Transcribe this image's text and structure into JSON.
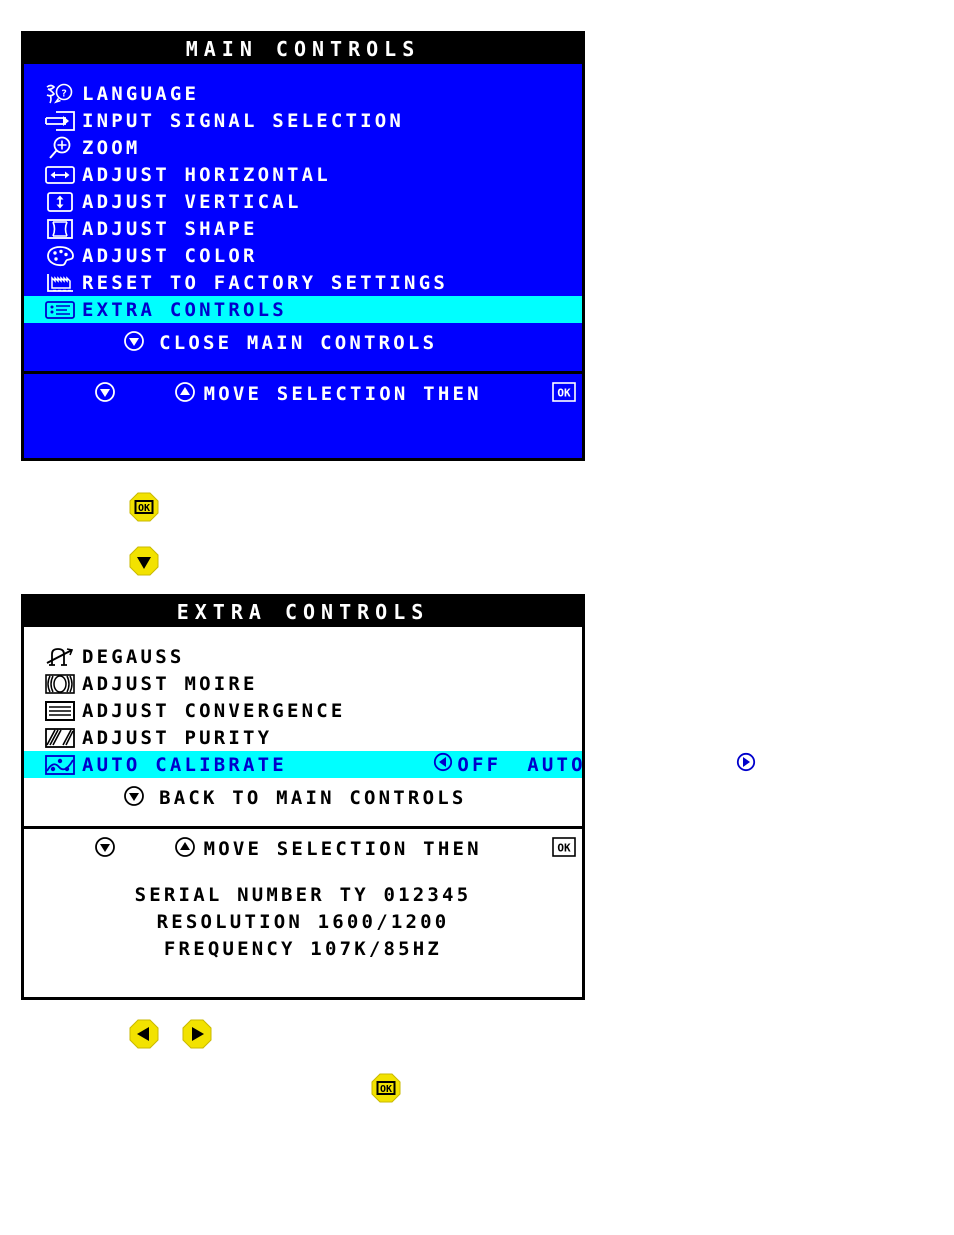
{
  "main_controls": {
    "title": "MAIN CONTROLS",
    "items": [
      {
        "icon": "language-icon",
        "label": "LANGUAGE",
        "selected": false
      },
      {
        "icon": "input-signal-icon",
        "label": "INPUT SIGNAL SELECTION",
        "selected": false
      },
      {
        "icon": "zoom-icon",
        "label": "ZOOM",
        "selected": false
      },
      {
        "icon": "adjust-horizontal-icon",
        "label": "ADJUST HORIZONTAL",
        "selected": false
      },
      {
        "icon": "adjust-vertical-icon",
        "label": "ADJUST VERTICAL",
        "selected": false
      },
      {
        "icon": "adjust-shape-icon",
        "label": "ADJUST SHAPE",
        "selected": false
      },
      {
        "icon": "adjust-color-icon",
        "label": "ADJUST COLOR",
        "selected": false
      },
      {
        "icon": "factory-reset-icon",
        "label": "RESET TO FACTORY SETTINGS",
        "selected": false
      },
      {
        "icon": "extra-controls-icon",
        "label": "EXTRA CONTROLS",
        "selected": true
      }
    ],
    "close_icon": "down-arrow-circle-icon",
    "close_label": "CLOSE MAIN CONTROLS",
    "hint_icon_down": "down-arrow-circle-icon",
    "hint_icon_up": "up-arrow-circle-icon",
    "hint_label": "MOVE SELECTION THEN",
    "hint_ok_icon": "ok-key-icon",
    "hint_ok_label": "OK"
  },
  "extra_controls": {
    "title": "EXTRA CONTROLS",
    "items": [
      {
        "icon": "degauss-icon",
        "label": "DEGAUSS",
        "selected": false
      },
      {
        "icon": "adjust-moire-icon",
        "label": "ADJUST MOIRE",
        "selected": false
      },
      {
        "icon": "adjust-convergence-icon",
        "label": "ADJUST CONVERGENCE",
        "selected": false
      },
      {
        "icon": "adjust-purity-icon",
        "label": "ADJUST PURITY",
        "selected": false
      },
      {
        "icon": "auto-calibrate-icon",
        "label": "AUTO CALIBRATE",
        "selected": true,
        "left_arrow_icon": "left-arrow-circle-icon",
        "option_off": "OFF",
        "option_auto": "AUTO",
        "right_arrow_icon": "right-arrow-circle-icon"
      }
    ],
    "back_icon": "down-arrow-circle-icon",
    "back_label": "BACK TO MAIN CONTROLS",
    "hint_icon_down": "down-arrow-circle-icon",
    "hint_icon_up": "up-arrow-circle-icon",
    "hint_label": "MOVE SELECTION THEN",
    "hint_ok_icon": "ok-key-icon",
    "hint_ok_label": "OK",
    "info": {
      "serial": "SERIAL NUMBER TY 012345",
      "resolution": "RESOLUTION 1600/1200",
      "frequency": "FREQUENCY 107K/85HZ"
    }
  },
  "buttons": [
    {
      "name": "ok-button-1",
      "icon": "ok-key-icon",
      "label": "OK"
    },
    {
      "name": "down-button-1",
      "icon": "down-arrow-button-icon",
      "label": "DOWN"
    },
    {
      "name": "left-button-1",
      "icon": "left-arrow-button-icon",
      "label": "LEFT"
    },
    {
      "name": "right-button-1",
      "icon": "right-arrow-button-icon",
      "label": "RIGHT"
    },
    {
      "name": "ok-button-2",
      "icon": "ok-key-icon",
      "label": "OK"
    }
  ],
  "colors": {
    "osd_blue": "#0000ff",
    "osd_cyan": "#00ffff",
    "osd_black": "#000000",
    "osd_white": "#ffffff",
    "button_yellow": "#f2e200",
    "highlight_text": "#0000cc"
  }
}
